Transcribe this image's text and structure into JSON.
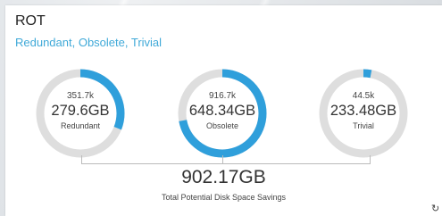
{
  "card": {
    "title": "ROT",
    "subtitle": "Redundant, Obsolete, Trivial"
  },
  "donuts": [
    {
      "count": "351.7k",
      "size": "279.6GB",
      "label": "Redundant",
      "fraction": 0.31
    },
    {
      "count": "916.7k",
      "size": "648.34GB",
      "label": "Obsolete",
      "fraction": 0.72
    },
    {
      "count": "44.5k",
      "size": "233.48GB",
      "label": "Trivial",
      "fraction": 0.03
    }
  ],
  "total": {
    "value": "902.17GB",
    "label": "Total Potential Disk Space Savings"
  },
  "colors": {
    "accent": "#2f9fdb",
    "track": "#dedede",
    "subtitle": "#3fa9d8"
  },
  "icons": {
    "refresh": "refresh-icon"
  }
}
